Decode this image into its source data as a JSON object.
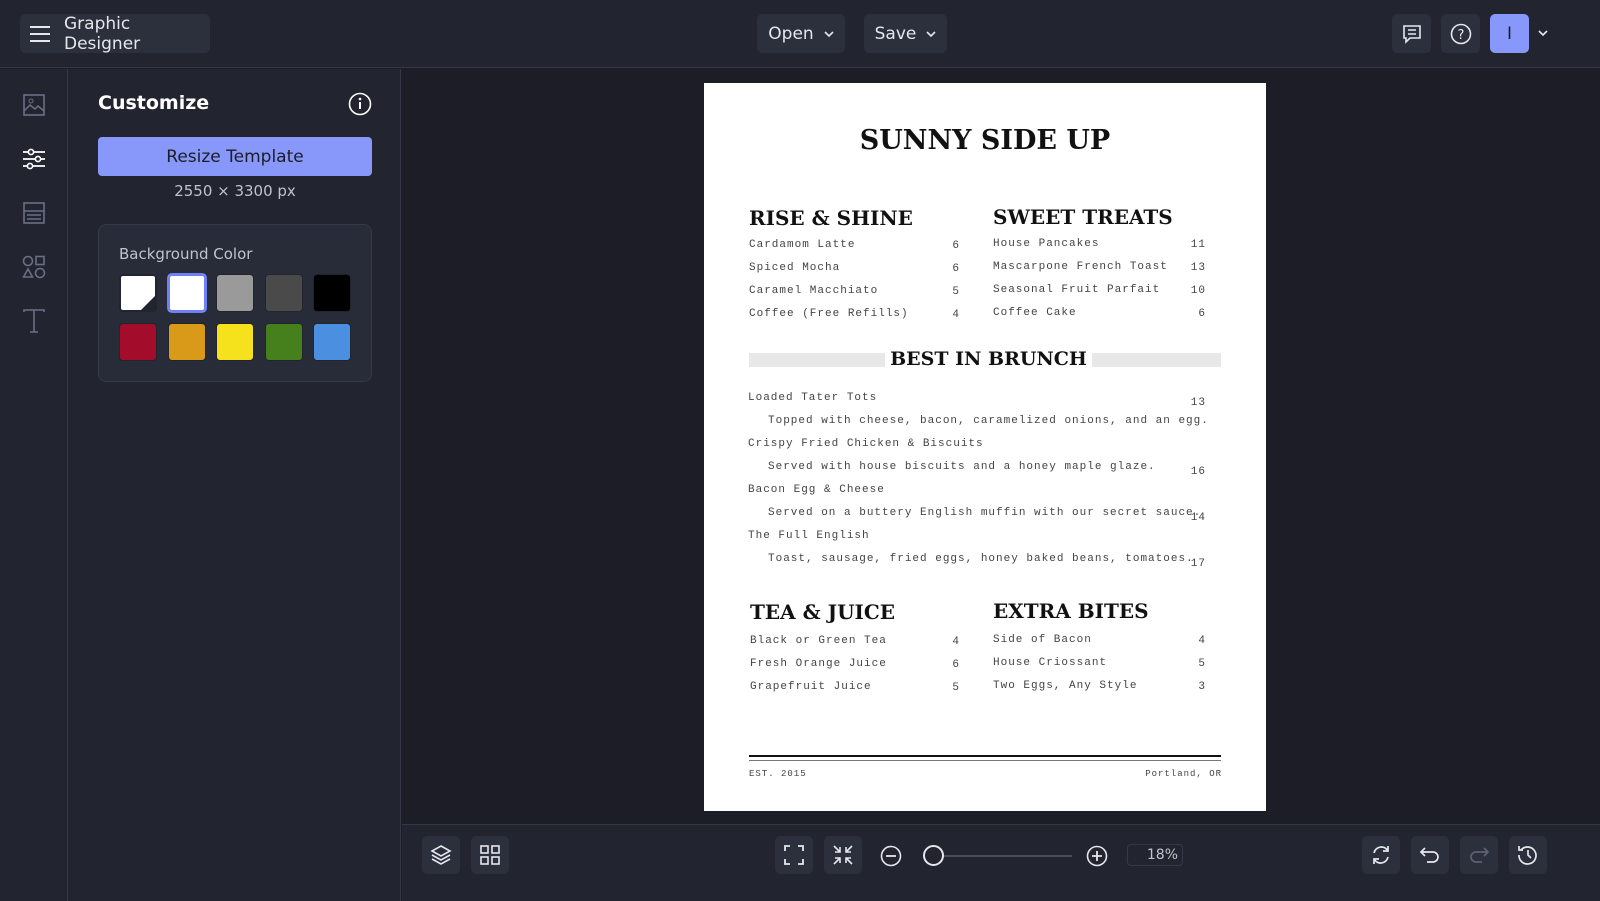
{
  "header": {
    "app_title": "Graphic Designer",
    "open_label": "Open",
    "save_label": "Save",
    "avatar_initial": "I"
  },
  "panel": {
    "title": "Customize",
    "resize_label": "Resize Template",
    "dimensions": "2550 × 3300 px",
    "bg_color_label": "Background Color",
    "swatches": [
      "transparent",
      "#ffffff",
      "#9a9a9a",
      "#4a4a4a",
      "#000000",
      "#a30d2b",
      "#d89a18",
      "#f5e11c",
      "#45801c",
      "#4a8fe0"
    ],
    "selected_swatch": 1
  },
  "bottom": {
    "zoom_label": "18%",
    "zoom_value": 18
  },
  "menu": {
    "title": "SUNNY SIDE UP",
    "rise": {
      "heading": "RISE & SHINE",
      "items": [
        {
          "name": "Cardamom Latte",
          "price": "6"
        },
        {
          "name": "Spiced Mocha",
          "price": "6"
        },
        {
          "name": "Caramel Macchiato",
          "price": "5"
        },
        {
          "name": "Coffee (Free Refills)",
          "price": "4"
        }
      ]
    },
    "sweet": {
      "heading": "SWEET TREATS",
      "items": [
        {
          "name": "House Pancakes",
          "price": "11"
        },
        {
          "name": "Mascarpone French Toast",
          "price": "13"
        },
        {
          "name": "Seasonal Fruit Parfait",
          "price": "10"
        },
        {
          "name": "Coffee Cake",
          "price": "6"
        }
      ]
    },
    "brunch": {
      "heading": "BEST IN BRUNCH",
      "items": [
        {
          "name": "Loaded Tater Tots",
          "desc": "Topped with cheese, bacon, caramelized onions, and an egg.",
          "price": "13"
        },
        {
          "name": "Crispy Fried Chicken & Biscuits",
          "desc": "Served with house biscuits and a honey maple glaze.",
          "price": "16"
        },
        {
          "name": "Bacon Egg & Cheese",
          "desc": "Served on a buttery English muffin with our secret sauce.",
          "price": "14"
        },
        {
          "name": "The Full English",
          "desc": "Toast, sausage, fried eggs, honey baked beans, tomatoes.",
          "price": "17"
        }
      ]
    },
    "tea": {
      "heading": "TEA & JUICE",
      "items": [
        {
          "name": "Black or Green Tea",
          "price": "4"
        },
        {
          "name": "Fresh Orange Juice",
          "price": "6"
        },
        {
          "name": "Grapefruit Juice",
          "price": "5"
        }
      ]
    },
    "extra": {
      "heading": "EXTRA BITES",
      "items": [
        {
          "name": "Side of Bacon",
          "price": "4"
        },
        {
          "name": "House Criossant",
          "price": "5"
        },
        {
          "name": "Two Eggs, Any Style",
          "price": "3"
        }
      ]
    },
    "footer_left": "EST. 2015",
    "footer_right": "Portland, OR"
  }
}
